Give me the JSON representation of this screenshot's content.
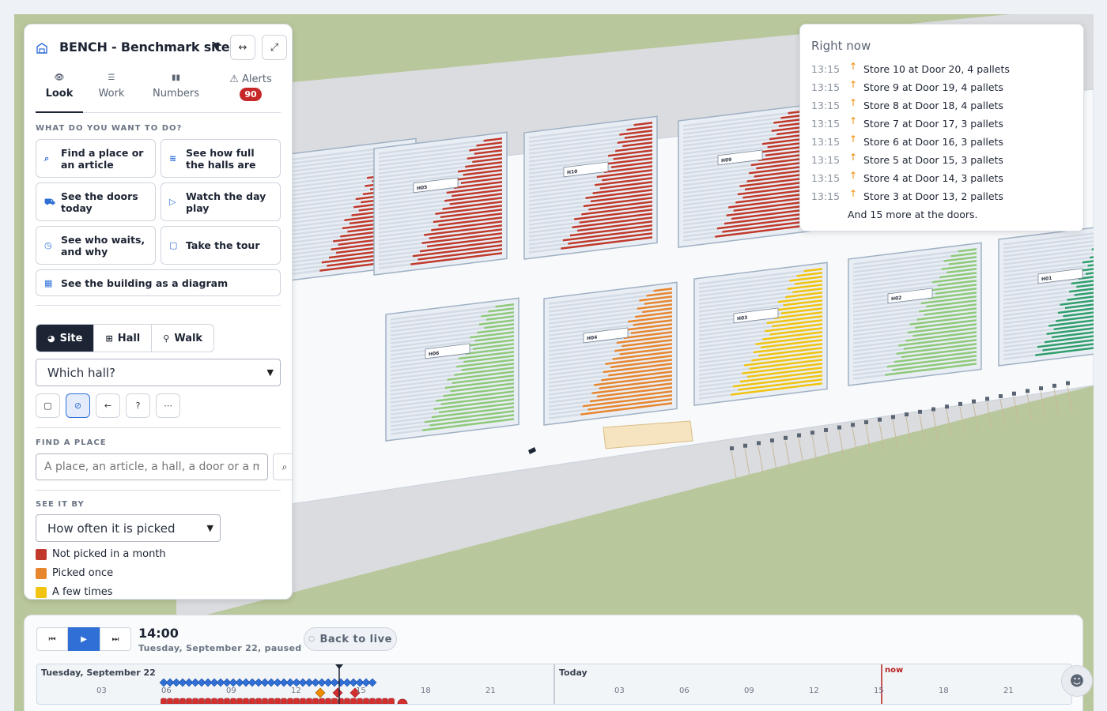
{
  "site": {
    "title": "BENCH - Benchmark site",
    "icon": "warehouse-icon"
  },
  "tabs": [
    {
      "label": "Look",
      "icon": "eye-icon",
      "active": true
    },
    {
      "label": "Work",
      "icon": "list-icon"
    },
    {
      "label": "Numbers",
      "icon": "bar-chart-icon"
    },
    {
      "label": "Alerts",
      "icon": "warning-icon",
      "badge": "90"
    }
  ],
  "what_to_do": {
    "label": "WHAT DO YOU WANT TO DO?",
    "actions": [
      {
        "label": "Find a place or an article",
        "icon": "search-icon"
      },
      {
        "label": "See how full the halls are",
        "icon": "layers-icon"
      },
      {
        "label": "See the doors today",
        "icon": "truck-icon"
      },
      {
        "label": "Watch the day play",
        "icon": "play-icon"
      },
      {
        "label": "See who waits, and why",
        "icon": "clock-icon"
      },
      {
        "label": "Take the tour",
        "icon": "frame-icon"
      },
      {
        "label": "See the building as a diagram",
        "icon": "grid-icon"
      }
    ]
  },
  "view_mode": {
    "options": [
      "Site",
      "Hall",
      "Walk"
    ],
    "active": "Site"
  },
  "hall_select": {
    "value": "Which hall?"
  },
  "find_place": {
    "label": "FIND A PLACE",
    "placeholder": "A place, an article, a hall, a door or a m"
  },
  "see_it_by": {
    "label": "SEE IT BY",
    "value": "How often it is picked",
    "legend": [
      {
        "label": "Not picked in a month",
        "color": "#c0392b"
      },
      {
        "label": "Picked once",
        "color": "#e8862e"
      },
      {
        "label": "A few times",
        "color": "#f1c40f"
      }
    ]
  },
  "right_now": {
    "title": "Right now",
    "items": [
      {
        "time": "13:15",
        "text": "Store 10 at Door 20, 4 pallets"
      },
      {
        "time": "13:15",
        "text": "Store 9 at Door 19, 4 pallets"
      },
      {
        "time": "13:15",
        "text": "Store 8 at Door 18, 4 pallets"
      },
      {
        "time": "13:15",
        "text": "Store 7 at Door 17, 3 pallets"
      },
      {
        "time": "13:15",
        "text": "Store 6 at Door 16, 3 pallets"
      },
      {
        "time": "13:15",
        "text": "Store 5 at Door 15, 3 pallets"
      },
      {
        "time": "13:15",
        "text": "Store 4 at Door 14, 3 pallets"
      },
      {
        "time": "13:15",
        "text": "Store 3 at Door 13, 2 pallets"
      }
    ],
    "more": "And 15 more at the doors."
  },
  "timeline": {
    "time": "14:00",
    "date": "Tuesday, September 22, paused",
    "back_to_live": "Back to live",
    "day1": "Tuesday, September 22",
    "day2": "Today",
    "now_label": "now",
    "hours_day1": [
      "03",
      "06",
      "09",
      "12",
      "15",
      "18",
      "21"
    ],
    "hours_day2": [
      "03",
      "06",
      "09",
      "12",
      "15",
      "18",
      "21"
    ]
  },
  "halls": [
    {
      "label": "H05",
      "color": "#c0392b"
    },
    {
      "label": "H10",
      "color": "#c0392b"
    },
    {
      "label": "H09",
      "color": "#c0392b"
    },
    {
      "label": "H06",
      "color": "#8fc97a"
    },
    {
      "label": "H04",
      "color": "#e8862e"
    },
    {
      "label": "H03",
      "color": "#f1c40f"
    },
    {
      "label": "H02",
      "color": "#8fc97a"
    },
    {
      "label": "H01",
      "color": "#2e9e6b"
    }
  ]
}
